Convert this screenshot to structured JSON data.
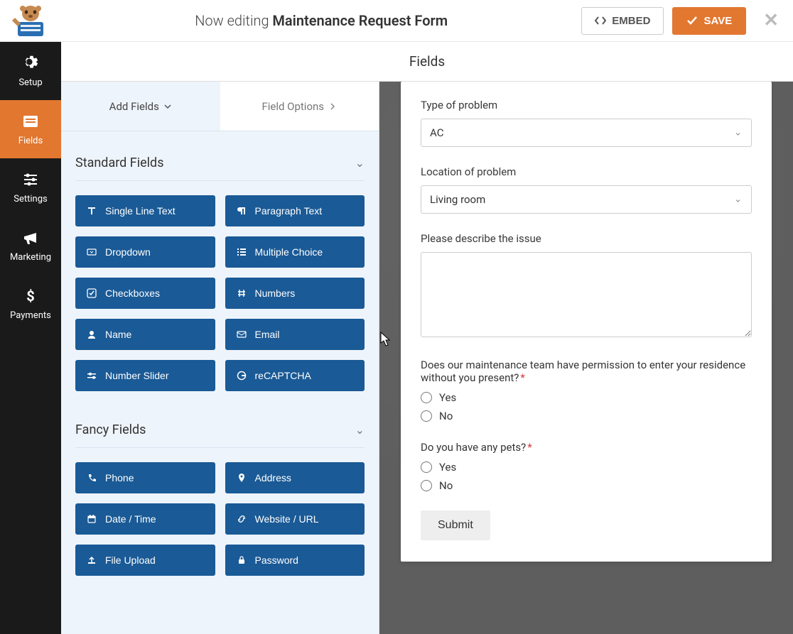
{
  "header": {
    "editing_prefix": "Now editing",
    "form_name": "Maintenance Request Form",
    "embed_label": "EMBED",
    "save_label": "SAVE"
  },
  "nav": {
    "setup": "Setup",
    "fields": "Fields",
    "settings": "Settings",
    "marketing": "Marketing",
    "payments": "Payments"
  },
  "builder": {
    "title": "Fields",
    "tab_add": "Add Fields",
    "tab_options": "Field Options"
  },
  "sections": {
    "standard": {
      "title": "Standard Fields",
      "items": [
        {
          "label": "Single Line Text",
          "icon": "text"
        },
        {
          "label": "Paragraph Text",
          "icon": "paragraph"
        },
        {
          "label": "Dropdown",
          "icon": "dropdown"
        },
        {
          "label": "Multiple Choice",
          "icon": "list"
        },
        {
          "label": "Checkboxes",
          "icon": "check"
        },
        {
          "label": "Numbers",
          "icon": "hash"
        },
        {
          "label": "Name",
          "icon": "user"
        },
        {
          "label": "Email",
          "icon": "envelope"
        },
        {
          "label": "Number Slider",
          "icon": "slider"
        },
        {
          "label": "reCAPTCHA",
          "icon": "google"
        }
      ]
    },
    "fancy": {
      "title": "Fancy Fields",
      "items": [
        {
          "label": "Phone",
          "icon": "phone"
        },
        {
          "label": "Address",
          "icon": "pin"
        },
        {
          "label": "Date / Time",
          "icon": "calendar"
        },
        {
          "label": "Website / URL",
          "icon": "link"
        },
        {
          "label": "File Upload",
          "icon": "upload"
        },
        {
          "label": "Password",
          "icon": "lock"
        }
      ]
    }
  },
  "form": {
    "type_label": "Type of problem",
    "type_value": "AC",
    "location_label": "Location of problem",
    "location_value": "Living room",
    "describe_label": "Please describe the issue",
    "permission_label": "Does our maintenance team have permission to enter your residence without you present?",
    "pets_label": "Do you have any pets?",
    "yes": "Yes",
    "no": "No",
    "submit": "Submit"
  }
}
